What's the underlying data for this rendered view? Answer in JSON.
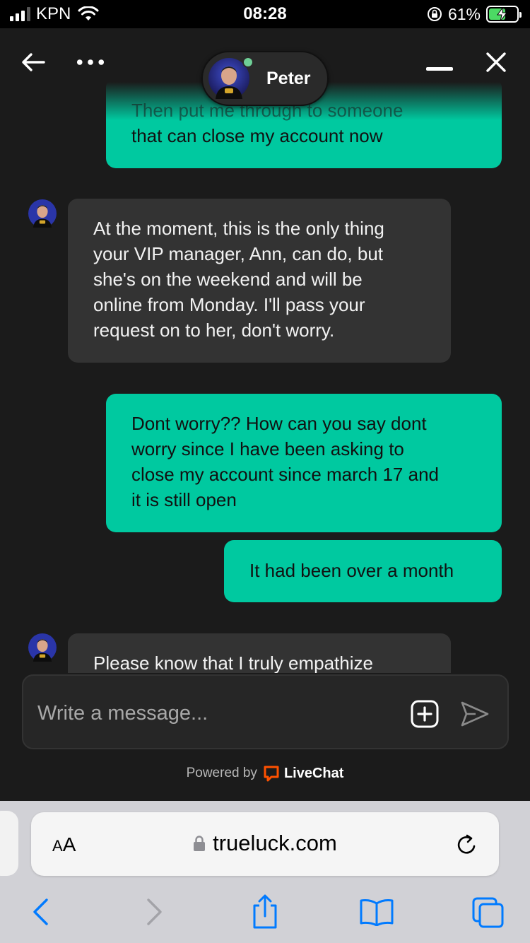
{
  "status_bar": {
    "carrier": "KPN",
    "time": "08:28",
    "battery": "61%",
    "battery_level": 0.61,
    "icons": [
      "signal-icon",
      "wifi-icon",
      "rotation-lock-icon",
      "battery-charging-icon"
    ]
  },
  "chat_header": {
    "agent_name": "Peter",
    "agent_online": true,
    "icons": [
      "back-arrow-icon",
      "more-icon",
      "minimize-icon",
      "close-icon"
    ]
  },
  "messages": [
    {
      "sender": "user",
      "lines": [
        "Then put me through to someone",
        "that can close my account now"
      ]
    },
    {
      "sender": "agent",
      "lines": [
        "At the moment, this is the only thing",
        "your VIP manager, Ann, can do, but",
        "she's on the weekend and will be",
        "online from Monday. I'll pass your",
        "request on to her, don't worry."
      ]
    },
    {
      "sender": "user",
      "lines": [
        "Dont worry?? How can you say dont",
        "worry since I have been asking to",
        "close my account since march 17 and",
        "it is still open"
      ]
    },
    {
      "sender": "user",
      "lines": [
        "It had been over a month"
      ]
    },
    {
      "sender": "agent",
      "lines": [
        "Please know that I truly empathize"
      ]
    }
  ],
  "composer": {
    "placeholder": "Write a message...",
    "icons": [
      "attach-plus-icon",
      "send-icon"
    ]
  },
  "footer": {
    "powered_by": "Powered by",
    "brand": "LiveChat",
    "brand_color": "#ff5100"
  },
  "browser": {
    "aa_label_big": "A",
    "aa_label_small": "A",
    "url": "trueluck.com",
    "accent_color": "#007aff",
    "icons": [
      "lock-icon",
      "reload-icon",
      "back-icon",
      "forward-icon",
      "share-icon",
      "bookmarks-icon",
      "tabs-icon"
    ]
  },
  "colors": {
    "user_bubble": "#00c9a0",
    "agent_bubble": "#333333",
    "background": "#1b1b1b"
  }
}
